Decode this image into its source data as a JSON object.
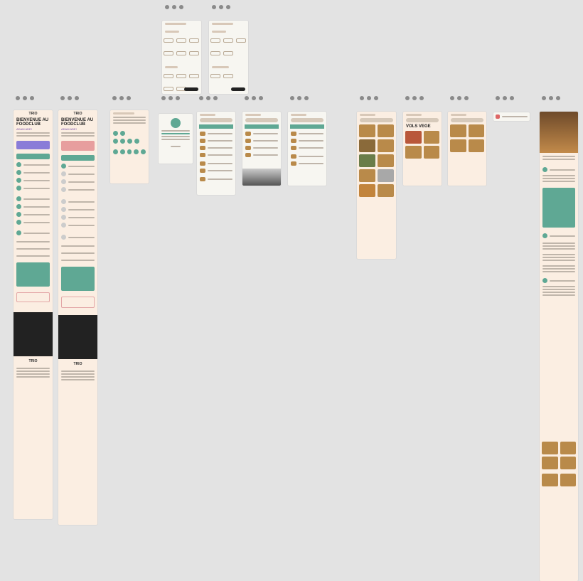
{
  "canvas": {
    "background": "#e3e3e3"
  },
  "mobile_brand": {
    "logo_text": "TRIO",
    "welcome_heading": "BIENVENUE AU FOODCLUB",
    "welcome_sub": "ADAM ADE!"
  },
  "colors": {
    "accent": "#5fa894",
    "frame": "#fbeee2",
    "dark": "#222222",
    "highlight": "#7a4fa8"
  },
  "frames": [
    {
      "id": "filters-a",
      "kind": "filter-sheet"
    },
    {
      "id": "filters-b",
      "kind": "filter-sheet"
    },
    {
      "id": "menu-1",
      "kind": "account-menu"
    },
    {
      "id": "menu-2",
      "kind": "account-menu"
    },
    {
      "id": "settings",
      "kind": "form"
    },
    {
      "id": "modal",
      "kind": "dialog"
    },
    {
      "id": "list-1",
      "kind": "list"
    },
    {
      "id": "list-2",
      "kind": "list"
    },
    {
      "id": "list-3",
      "kind": "list"
    },
    {
      "id": "grid-1",
      "kind": "recipe-grid"
    },
    {
      "id": "grid-2",
      "kind": "recipe-grid"
    },
    {
      "id": "grid-3",
      "kind": "recipe-grid"
    },
    {
      "id": "toast",
      "kind": "notification"
    },
    {
      "id": "detail",
      "kind": "recipe-detail"
    }
  ]
}
